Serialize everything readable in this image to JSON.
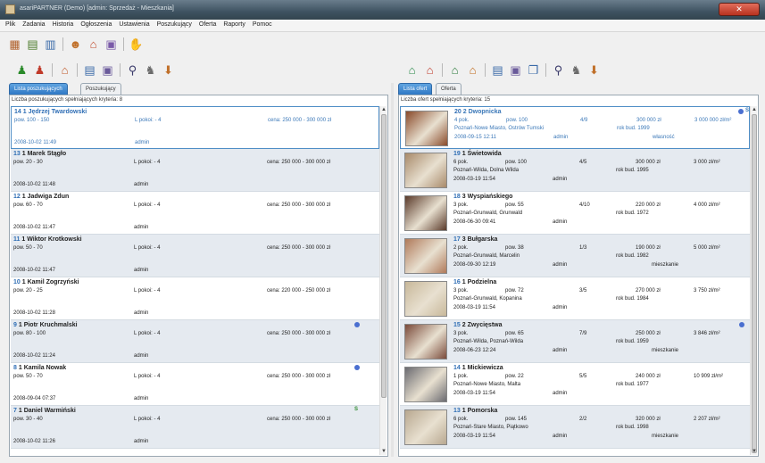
{
  "window": {
    "title": "asariPARTNER (Demo) [admin: Sprzedaż - Mieszkania]",
    "controls": "✕"
  },
  "menu": [
    "Plik",
    "Zadania",
    "Historia",
    "Ogłoszenia",
    "Ustawienia",
    "Poszukujący",
    "Oferta",
    "Raporty",
    "Pomoc"
  ],
  "toolbar_top": [
    "grid-icon",
    "calendar-icon",
    "list-icon",
    "people-icon",
    "house-search-icon",
    "document-icon",
    "hand-icon"
  ],
  "left_toolbar": [
    "add-person-icon",
    "remove-person-icon",
    "house-person-icon",
    "print-icon",
    "printer-icon",
    "magnify-icon",
    "search-person-icon",
    "filter-icon"
  ],
  "right_toolbar": [
    "house-add-icon",
    "house-remove-icon",
    "house-edit-icon",
    "house-key-icon",
    "print-icon",
    "printer-icon",
    "copy-icon",
    "magnify-icon",
    "search-person-icon",
    "filter-icon"
  ],
  "left_panel": {
    "tabs": [
      "Lista poszukujących",
      "Poszukujący"
    ],
    "count_label": "Liczba poszukujących spełniających kryteria: 8",
    "rows": [
      {
        "num": "14",
        "rest": "1 Jędrzej Twardowski",
        "area": "pow. 100 - 150",
        "rooms": "L pokoi: - 4",
        "price": "cena: 250 000 - 300 000 zł",
        "date": "2008-10-02 11:49",
        "user": "admin",
        "dot": false,
        "flag": ""
      },
      {
        "num": "13",
        "rest": "1 Marek Stągło",
        "area": "pow. 20 - 30",
        "rooms": "L pokoi: - 4",
        "price": "cena: 250 000 - 300 000 zł",
        "date": "2008-10-02 11:48",
        "user": "admin",
        "dot": false,
        "flag": ""
      },
      {
        "num": "12",
        "rest": "1 Jadwiga Zdun",
        "area": "pow. 60 - 70",
        "rooms": "L pokoi: - 4",
        "price": "cena: 250 000 - 300 000 zł",
        "date": "2008-10-02 11:47",
        "user": "admin",
        "dot": false,
        "flag": ""
      },
      {
        "num": "11",
        "rest": "1 Wiktor Krotkowski",
        "area": "pow. 50 - 70",
        "rooms": "L pokoi: - 4",
        "price": "cena: 250 000 - 300 000 zł",
        "date": "2008-10-02 11:47",
        "user": "admin",
        "dot": false,
        "flag": ""
      },
      {
        "num": "10",
        "rest": "1 Kamil Zogrzyński",
        "area": "pow. 20 - 25",
        "rooms": "L pokoi: - 4",
        "price": "cena: 220 000 - 250 000 zł",
        "date": "2008-10-02 11:28",
        "user": "admin",
        "dot": false,
        "flag": ""
      },
      {
        "num": "9",
        "rest": "1 Piotr Kruchmalski",
        "area": "pow. 80 - 100",
        "rooms": "L pokoi: - 4",
        "price": "cena: 250 000 - 300 000 zł",
        "date": "2008-10-02 11:24",
        "user": "admin",
        "dot": true,
        "flag": ""
      },
      {
        "num": "8",
        "rest": "1 Kamila Nowak",
        "area": "pow. 50 - 70",
        "rooms": "L pokoi: - 4",
        "price": "cena: 250 000 - 300 000 zł",
        "date": "2008-09-04 07:37",
        "user": "admin",
        "dot": true,
        "flag": ""
      },
      {
        "num": "7",
        "rest": "1 Daniel Warmiński",
        "area": "pow. 30 - 40",
        "rooms": "L pokoi: - 4",
        "price": "cena: 250 000 - 300 000 zł",
        "date": "2008-10-02 11:26",
        "user": "admin",
        "dot": false,
        "flag": "S"
      }
    ]
  },
  "right_panel": {
    "tabs": [
      "Lista ofert",
      "Oferta"
    ],
    "count_label": "Liczba ofert spełniających kryteria: 15",
    "rows": [
      {
        "num": "20",
        "rest": "2 Dwopnicka",
        "type": "4 pok.",
        "area": "pow. 100",
        "floor": "4/9",
        "price": "300 000 zł",
        "ppm": "3 000 000 zł/m²",
        "loc": "Poznań-Nowe Miasto, Ostrów Tumski",
        "year": "rok bud. 1999",
        "date": "2008-09-15 12:11",
        "user": "admin",
        "own": "własność",
        "dot": true,
        "flag": "S",
        "photo": "#8a4a2a"
      },
      {
        "num": "19",
        "rest": "1 Świetowida",
        "type": "6 pok.",
        "area": "pow. 100",
        "floor": "4/5",
        "price": "300 000 zł",
        "ppm": "3 000 zł/m²",
        "loc": "Poznań-Wilda, Dolna Wilda",
        "year": "rok bud. 1995",
        "date": "2008-03-19 11:54",
        "user": "admin",
        "own": "",
        "dot": false,
        "flag": "",
        "photo": "#a88a6a"
      },
      {
        "num": "18",
        "rest": "3 Wyspiańskiego",
        "type": "3 pok.",
        "area": "pow. 55",
        "floor": "4/10",
        "price": "220 000 zł",
        "ppm": "4 000 zł/m²",
        "loc": "Poznań-Grunwald, Grunwald",
        "year": "rok bud. 1972",
        "date": "2008-06-30 09:41",
        "user": "admin",
        "own": "",
        "dot": false,
        "flag": "",
        "photo": "#5a3a2a"
      },
      {
        "num": "17",
        "rest": "3 Bułgarska",
        "type": "2 pok.",
        "area": "pow. 38",
        "floor": "1/3",
        "price": "190 000 zł",
        "ppm": "5 000 zł/m²",
        "loc": "Poznań-Grunwald, Marcelin",
        "year": "rok bud. 1982",
        "date": "2008-09-30 12:19",
        "user": "admin",
        "own": "mieszkanie",
        "dot": false,
        "flag": "",
        "photo": "#b07a5a"
      },
      {
        "num": "16",
        "rest": "1 Podzielna",
        "type": "3 pok.",
        "area": "pow. 72",
        "floor": "3/5",
        "price": "270 000 zł",
        "ppm": "3 750 zł/m²",
        "loc": "Poznań-Grunwald, Kopanina",
        "year": "rok bud. 1984",
        "date": "2008-03-19 11:54",
        "user": "admin",
        "own": "",
        "dot": false,
        "flag": "",
        "photo": "#c8b89a"
      },
      {
        "num": "15",
        "rest": "2 Zwycięstwa",
        "type": "3 pok.",
        "area": "pow. 65",
        "floor": "7/9",
        "price": "250 000 zł",
        "ppm": "3 846 zł/m²",
        "loc": "Poznań-Wilda, Poznań-Wilda",
        "year": "rok bud. 1959",
        "date": "2008-06-23 12:24",
        "user": "admin",
        "own": "mieszkanie",
        "dot": true,
        "flag": "",
        "photo": "#7a4a3a"
      },
      {
        "num": "14",
        "rest": "1 Mickiewicza",
        "type": "1 pok.",
        "area": "pow. 22",
        "floor": "5/5",
        "price": "240 000 zł",
        "ppm": "10 909 zł/m²",
        "loc": "Poznań-Nowe Miasto, Malta",
        "year": "rok bud. 1977",
        "date": "2008-03-19 11:54",
        "user": "admin",
        "own": "",
        "dot": false,
        "flag": "",
        "photo": "#6a6a70"
      },
      {
        "num": "13",
        "rest": "1 Pomorska",
        "type": "6 pok.",
        "area": "pow. 145",
        "floor": "2/2",
        "price": "320 000 zł",
        "ppm": "2 207 zł/m²",
        "loc": "Poznań-Stare Miasto, Piątkowo",
        "year": "rok bud. 1998",
        "date": "2008-03-19 11:54",
        "user": "admin",
        "own": "mieszkanie",
        "dot": false,
        "flag": "",
        "photo": "#b8a890"
      }
    ]
  }
}
